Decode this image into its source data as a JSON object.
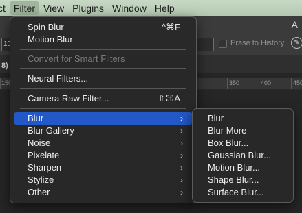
{
  "menubar": {
    "items": [
      "ct",
      "Filter",
      "View",
      "Plugins",
      "Window",
      "Help"
    ]
  },
  "options": {
    "top_right": "A",
    "left_value": "10",
    "erase_history": "Erase to History",
    "tab_fragment": "8)"
  },
  "ruler": {
    "labels": [
      "150",
      "350",
      "400",
      "450"
    ]
  },
  "filter_menu": {
    "spin_blur": {
      "label": "Spin Blur",
      "shortcut": "^⌘F"
    },
    "motion_blur": "Motion Blur",
    "convert_smart": "Convert for Smart Filters",
    "neural_filters": "Neural Filters...",
    "camera_raw": {
      "label": "Camera Raw Filter...",
      "shortcut": "⇧⌘A"
    },
    "submenus": [
      "Blur",
      "Blur Gallery",
      "Noise",
      "Pixelate",
      "Sharpen",
      "Stylize",
      "Other"
    ],
    "chevron": "›"
  },
  "blur_submenu": {
    "items": [
      "Blur",
      "Blur More",
      "Box Blur...",
      "Gaussian Blur...",
      "Motion Blur...",
      "Shape Blur...",
      "Surface Blur..."
    ]
  },
  "colors": {
    "highlight": "#2358c9",
    "menubar": "#c1d4be"
  }
}
